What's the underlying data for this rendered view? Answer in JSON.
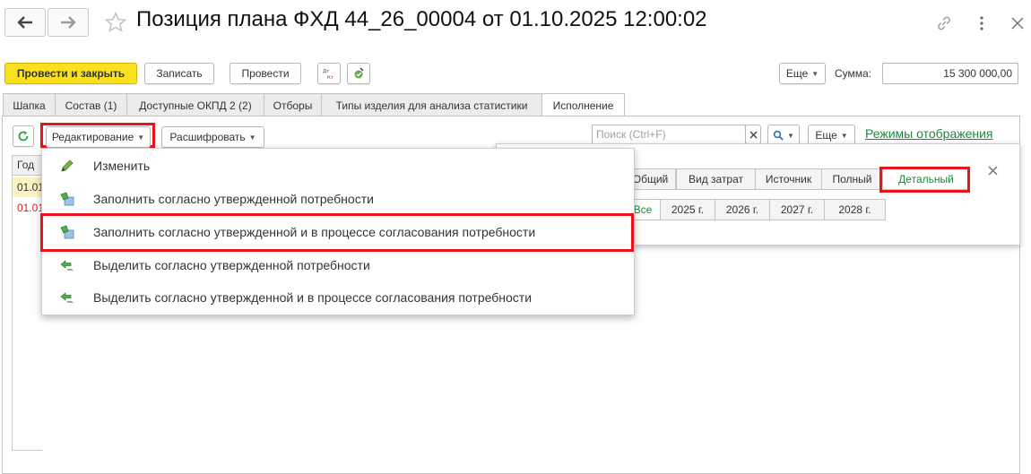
{
  "window": {
    "title": "Позиция плана ФХД 44_26_00004 от 01.10.2025 12:00:02",
    "back_icon": "arrow-left-icon",
    "forward_icon": "arrow-right-icon",
    "favorite_icon": "star-icon",
    "link_icon": "link-icon",
    "more_icon": "more-vertical-icon",
    "close_icon": "close-icon"
  },
  "toolbar": {
    "post_and_close": "Провести и закрыть",
    "save": "Записать",
    "post": "Провести",
    "dt_kt_icon": "Дт Кт",
    "more": "Еще",
    "sum_label": "Сумма:",
    "sum_value": "15 300 000,00"
  },
  "tabs": [
    {
      "label": "Шапка"
    },
    {
      "label": "Состав (1)"
    },
    {
      "label": "Доступные ОКПД 2 (2)"
    },
    {
      "label": "Отборы"
    },
    {
      "label": "Типы изделия для анализа статистики"
    },
    {
      "label": "Исполнение"
    }
  ],
  "panel_toolbar": {
    "editing": "Редактирование",
    "decode": "Расшифровать",
    "search_placeholder": "Поиск (Ctrl+F)",
    "more": "Еще",
    "display_modes": "Режимы отображения"
  },
  "grid": {
    "header": "Год",
    "rows": [
      "01.01",
      "01.01"
    ]
  },
  "modes_panel": {
    "modes": [
      "Общий",
      "Вид затрат",
      "Источник",
      "Полный",
      "Детальный"
    ],
    "years": [
      "Все",
      "2025 г.",
      "2026 г.",
      "2027 г.",
      "2028 г."
    ]
  },
  "menu": {
    "items": [
      {
        "label": "Изменить",
        "icon": "pencil-icon"
      },
      {
        "label": "Заполнить согласно утвержденной потребности",
        "icon": "fill-icon"
      },
      {
        "label": "Заполнить согласно утвержденной и в процессе согласования потребности",
        "icon": "fill-icon"
      },
      {
        "label": "Выделить согласно утвержденной потребности",
        "icon": "select-icon"
      },
      {
        "label": "Выделить согласно утвержденной и в процессе согласования потребности",
        "icon": "select-icon"
      }
    ]
  },
  "colors": {
    "primary_button": "#fbe020",
    "highlight_red": "#e8141b",
    "link_green": "#1a8a3a",
    "row_yellow": "#fbf3c2",
    "row_red_text": "#d21f1f"
  }
}
